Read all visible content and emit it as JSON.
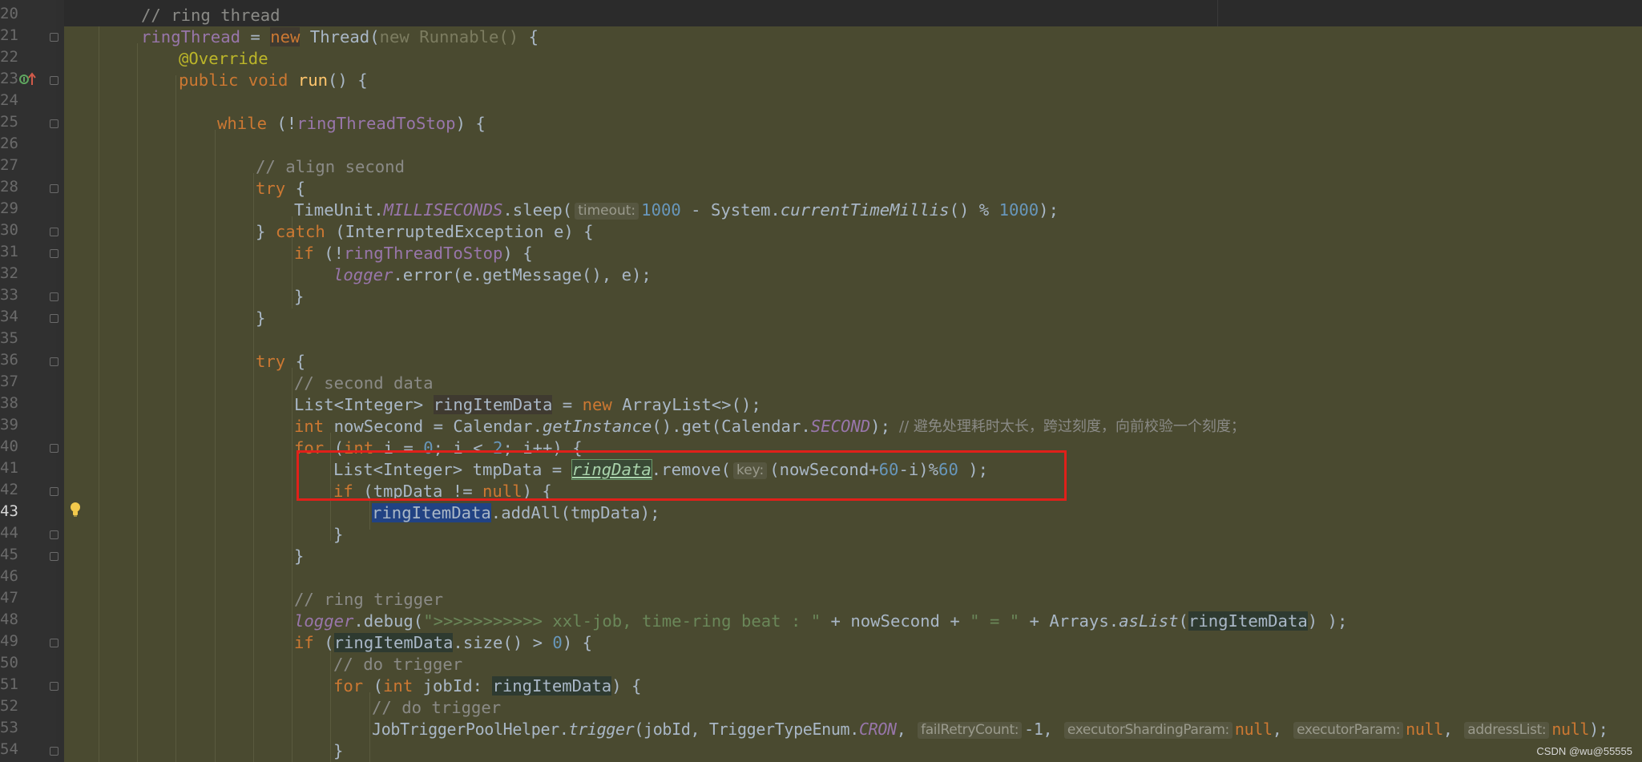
{
  "editor": {
    "line_numbers": [
      "20",
      "21",
      "22",
      "23",
      "24",
      "25",
      "26",
      "27",
      "28",
      "29",
      "30",
      "31",
      "32",
      "33",
      "34",
      "35",
      "36",
      "37",
      "38",
      "39",
      "40",
      "41",
      "42",
      "43",
      "44",
      "45",
      "46",
      "47",
      "48",
      "49",
      "50",
      "51",
      "52",
      "53",
      "54"
    ],
    "lines": {
      "l20_comment": "// ring thread",
      "l21_field": "ringThread",
      "l21_eq": " = ",
      "l21_new": "new",
      "l21_thread": " Thread(",
      "l21_anon": "new Runnable() ",
      "l21_brace": "{",
      "l22_ann": "@Override",
      "l23_pub": "public void ",
      "l23_run": "run",
      "l23_rest": "() {",
      "l25_while": "while",
      "l25_open": " (!",
      "l25_field": "ringThreadToStop",
      "l25_close": ") {",
      "l27_comment": "// align second",
      "l28_try": "try",
      "l28_brace": " {",
      "l29_cls": "TimeUnit.",
      "l29_const": "MILLISECONDS",
      "l29_call": ".sleep(",
      "l29_hint": "timeout:",
      "l29_num1": "1000",
      "l29_mid": " - System.",
      "l29_static": "currentTimeMillis",
      "l29_mod": "() % ",
      "l29_num2": "1000",
      "l29_end": ");",
      "l30_open": "} ",
      "l30_catch": "catch",
      "l30_rest": " (InterruptedException e) {",
      "l31_if": "if",
      "l31_open": " (!",
      "l31_field": "ringThreadToStop",
      "l31_close": ") {",
      "l32_logger": "logger",
      "l32_rest": ".error(e.getMessage(), e);",
      "l33": "}",
      "l34": "}",
      "l36_try": "try",
      "l36_brace": " {",
      "l37_comment": "// second data",
      "l38_type": "List<Integer> ",
      "l38_var": "ringItemData",
      "l38_eq": " = ",
      "l38_new": "new",
      "l38_rest": " ArrayList<>();",
      "l39_int": "int",
      "l39_var": " nowSecond = Calendar.",
      "l39_static": "getInstance",
      "l39_get": "().get(Calendar.",
      "l39_const": "SECOND",
      "l39_end": ");",
      "l39_comment": "// 避免处理耗时太长，跨过刻度，向前校验一个刻度；",
      "l40_for": "for",
      "l40_open": " (",
      "l40_int": "int",
      "l40_mid": " i = ",
      "l40_num0": "0",
      "l40_mid2": "; i < ",
      "l40_num2": "2",
      "l40_end": "; i++) {",
      "l41_type": "List<Integer> tmpData = ",
      "l41_field": "ringData",
      "l41_call": ".remove(",
      "l41_hint": "key:",
      "l41_arg": "(nowSecond+",
      "l41_num60a": "60",
      "l41_arg2": "-i)%",
      "l41_num60b": "60",
      "l41_end": " );",
      "l42_if": "if",
      "l42_open": " (tmpData != ",
      "l42_null": "null",
      "l42_close": ") {",
      "l43_var": "ringItemData",
      "l43_rest": ".addAll(tmpData);",
      "l44": "}",
      "l45": "}",
      "l47_comment": "// ring trigger",
      "l48_logger": "logger",
      "l48_debug": ".debug(",
      "l48_str": "\">>>>>>>>>>> xxl-job, time-ring beat : \"",
      "l48_plus1": " + nowSecond + ",
      "l48_str2": "\" = \"",
      "l48_plus2": " + Arrays.",
      "l48_static": "asList",
      "l48_open": "(",
      "l48_var": "ringItemData",
      "l48_end": ") );",
      "l49_if": "if",
      "l49_open": " (",
      "l49_var": "ringItemData",
      "l49_size": ".size() > ",
      "l49_num": "0",
      "l49_close": ") {",
      "l50_comment": "// do trigger",
      "l51_for": "for",
      "l51_open": " (",
      "l51_int": "int",
      "l51_mid": " jobId: ",
      "l51_var": "ringItemData",
      "l51_close": ") {",
      "l52_comment": "// do trigger",
      "l53_cls": "JobTriggerPoolHelper.",
      "l53_static": "trigger",
      "l53_args": "(jobId, TriggerTypeEnum.",
      "l53_const": "CRON",
      "l53_comma": ", ",
      "l53_hint1": "failRetryCount:",
      "l53_val1": "-1, ",
      "l53_hint2": "executorShardingParam:",
      "l53_null1": "null",
      "l53_c2": ", ",
      "l53_hint3": "executorParam:",
      "l53_null2": "null",
      "l53_c3": ", ",
      "l53_hint4": "addressList:",
      "l53_null3": "null",
      "l53_end": ");",
      "l54": "}"
    }
  },
  "watermark": "CSDN @wu@55555",
  "colors": {
    "editor_bg": "#4a4a30",
    "highlight_box": "#e0201a",
    "keyword": "#cc7832",
    "comment": "#8a8a86"
  },
  "icons": [
    "implements-gutter-icon",
    "bulb-icon",
    "fold-marker-icon"
  ]
}
